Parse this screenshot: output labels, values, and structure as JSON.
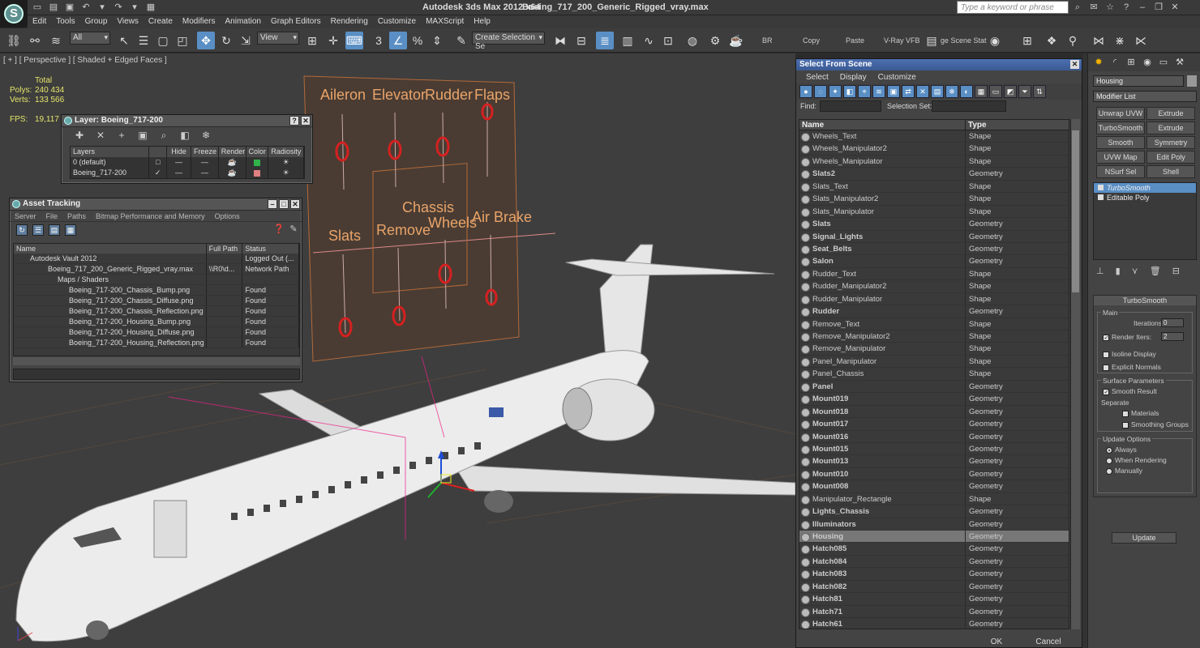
{
  "window": {
    "app_title": "Autodesk 3ds Max  2012 x64",
    "file_name": "Boeing_717_200_Generic_Rigged_vray.max",
    "search_placeholder": "Type a keyword or phrase",
    "logo": "3ds-max-logo"
  },
  "menu": [
    "Edit",
    "Tools",
    "Group",
    "Views",
    "Create",
    "Modifiers",
    "Animation",
    "Graph Editors",
    "Rendering",
    "Customize",
    "MAXScript",
    "Help"
  ],
  "toolbar": {
    "filter": "All",
    "ref_coord": "View",
    "selection_set_placeholder": "Create Selection Se",
    "br_label": "BR",
    "copy_label": "Copy",
    "paste_label": "Paste",
    "vray_label": "V-Ray VFB",
    "scene_state_label": "ge Scene Stat"
  },
  "viewport": {
    "label": "[ + ] [ Perspective ] [ Shaded + Edged Faces ]",
    "stats": {
      "total_label": "Total",
      "polys_label": "Polys:",
      "polys": "240 434",
      "verts_label": "Verts:",
      "verts": "133 566",
      "fps_label": "FPS:",
      "fps": "19,117"
    },
    "panel_labels": {
      "aileron": "Aileron",
      "elevator": "Elevator",
      "rudder": "Rudder",
      "flaps": "Flaps",
      "chassis": "Chassis",
      "slats": "Slats",
      "remove": "Remove",
      "wheels": "Wheels",
      "air_brake": "Air Brake"
    }
  },
  "layer_dialog": {
    "title": "Layer: Boeing_717-200",
    "columns": [
      "Layers",
      "",
      "Hide",
      "Freeze",
      "Render",
      "Color",
      "Radiosity"
    ],
    "rows": [
      {
        "name": "0 (default)",
        "color": "#2fb34a"
      },
      {
        "name": "Boeing_717-200",
        "color": "#e08080"
      }
    ]
  },
  "asset_dialog": {
    "title": "Asset Tracking",
    "menu": [
      "Server",
      "File",
      "Paths",
      "Bitmap Performance and Memory",
      "Options"
    ],
    "columns": [
      "Name",
      "Full Path",
      "Status"
    ],
    "rows": [
      {
        "name": "Autodesk Vault 2012",
        "path": "",
        "status": "Logged Out (..."
      },
      {
        "name": "Boeing_717_200_Generic_Rigged_vray.max",
        "path": "\\\\R0\\d...",
        "status": "Network Path"
      },
      {
        "name": "Maps / Shaders",
        "path": "",
        "status": ""
      },
      {
        "name": "Boeing_717-200_Chassis_Bump.png",
        "path": "",
        "status": "Found"
      },
      {
        "name": "Boeing_717-200_Chassis_Diffuse.png",
        "path": "",
        "status": "Found"
      },
      {
        "name": "Boeing_717-200_Chassis_Reflection.png",
        "path": "",
        "status": "Found"
      },
      {
        "name": "Boeing_717-200_Housing_Bump.png",
        "path": "",
        "status": "Found"
      },
      {
        "name": "Boeing_717-200_Housing_Diffuse.png",
        "path": "",
        "status": "Found"
      },
      {
        "name": "Boeing_717-200_Housing_Reflection.png",
        "path": "",
        "status": "Found"
      }
    ]
  },
  "select_from_scene": {
    "title": "Select From Scene",
    "menu": [
      "Select",
      "Display",
      "Customize"
    ],
    "find_label": "Find:",
    "selection_set_label": "Selection Set:",
    "col_name": "Name",
    "col_type": "Type",
    "items": [
      {
        "name": "Wheels_Text",
        "type": "Shape"
      },
      {
        "name": "Wheels_Manipulator2",
        "type": "Shape"
      },
      {
        "name": "Wheels_Manipulator",
        "type": "Shape"
      },
      {
        "name": "Slats2",
        "type": "Geometry"
      },
      {
        "name": "Slats_Text",
        "type": "Shape"
      },
      {
        "name": "Slats_Manipulator2",
        "type": "Shape"
      },
      {
        "name": "Slats_Manipulator",
        "type": "Shape"
      },
      {
        "name": "Slats",
        "type": "Geometry"
      },
      {
        "name": "Signal_Lights",
        "type": "Geometry"
      },
      {
        "name": "Seat_Belts",
        "type": "Geometry"
      },
      {
        "name": "Salon",
        "type": "Geometry"
      },
      {
        "name": "Rudder_Text",
        "type": "Shape"
      },
      {
        "name": "Rudder_Manipulator2",
        "type": "Shape"
      },
      {
        "name": "Rudder_Manipulator",
        "type": "Shape"
      },
      {
        "name": "Rudder",
        "type": "Geometry"
      },
      {
        "name": "Remove_Text",
        "type": "Shape"
      },
      {
        "name": "Remove_Manipulator2",
        "type": "Shape"
      },
      {
        "name": "Remove_Manipulator",
        "type": "Shape"
      },
      {
        "name": "Panel_Manipulator",
        "type": "Shape"
      },
      {
        "name": "Panel_Chassis",
        "type": "Shape"
      },
      {
        "name": "Panel",
        "type": "Geometry"
      },
      {
        "name": "Mount019",
        "type": "Geometry"
      },
      {
        "name": "Mount018",
        "type": "Geometry"
      },
      {
        "name": "Mount017",
        "type": "Geometry"
      },
      {
        "name": "Mount016",
        "type": "Geometry"
      },
      {
        "name": "Mount015",
        "type": "Geometry"
      },
      {
        "name": "Mount013",
        "type": "Geometry"
      },
      {
        "name": "Mount010",
        "type": "Geometry"
      },
      {
        "name": "Mount008",
        "type": "Geometry"
      },
      {
        "name": "Manipulator_Rectangle",
        "type": "Shape"
      },
      {
        "name": "Lights_Chassis",
        "type": "Geometry"
      },
      {
        "name": "Illuminators",
        "type": "Geometry"
      },
      {
        "name": "Housing",
        "type": "Geometry",
        "selected": true
      },
      {
        "name": "Hatch085",
        "type": "Geometry"
      },
      {
        "name": "Hatch084",
        "type": "Geometry"
      },
      {
        "name": "Hatch083",
        "type": "Geometry"
      },
      {
        "name": "Hatch082",
        "type": "Geometry"
      },
      {
        "name": "Hatch81",
        "type": "Geometry"
      },
      {
        "name": "Hatch71",
        "type": "Geometry"
      },
      {
        "name": "Hatch61",
        "type": "Geometry"
      }
    ],
    "ok_label": "OK",
    "cancel_label": "Cancel"
  },
  "command_panel": {
    "object_name": "Housing",
    "modifier_list": "Modifier List",
    "buttons": [
      "Unwrap UVW",
      "Extrude",
      "TurboSmooth",
      "Extrude",
      "Smooth",
      "Symmetry",
      "UVW Map",
      "Edit Poly",
      "NSurf Sel",
      "Shell"
    ],
    "stack": [
      "TurboSmooth",
      "Editable Poly"
    ],
    "rollout_title": "TurboSmooth",
    "main_label": "Main",
    "iterations_label": "Iterations:",
    "iterations": "0",
    "render_iters_label": "Render Iters:",
    "render_iters": "2",
    "isoline_label": "Isoline Display",
    "explicit_label": "Explicit Normals",
    "surface_label": "Surface Parameters",
    "smooth_result_label": "Smooth Result",
    "separate_label": "Separate",
    "materials_label": "Materials",
    "smoothing_groups_label": "Smoothing Groups",
    "update_options_label": "Update Options",
    "always_label": "Always",
    "when_rendering_label": "When Rendering",
    "manually_label": "Manually",
    "update_label": "Update"
  }
}
